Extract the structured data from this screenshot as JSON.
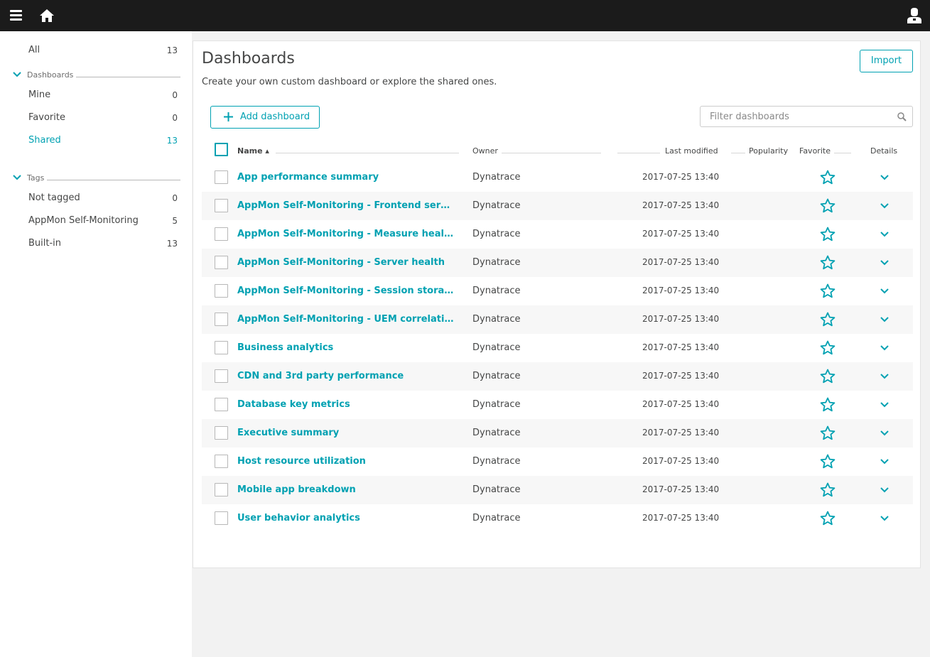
{
  "colors": {
    "accent": "#00a1b2",
    "topbar": "#1b1b1b",
    "text": "#454646",
    "background": "#f2f2f2"
  },
  "topbar": {
    "icons": [
      "menu-icon",
      "home-icon",
      "user-icon"
    ]
  },
  "sidebar": {
    "all": {
      "label": "All",
      "count": "13"
    },
    "groups": [
      {
        "label": "Dashboards",
        "items": [
          {
            "label": "Mine",
            "count": "0"
          },
          {
            "label": "Favorite",
            "count": "0"
          },
          {
            "label": "Shared",
            "count": "13",
            "active": true
          }
        ]
      },
      {
        "label": "Tags",
        "items": [
          {
            "label": "Not tagged",
            "count": "0"
          },
          {
            "label": "AppMon Self-Monitoring",
            "count": "5"
          },
          {
            "label": "Built-in",
            "count": "13"
          }
        ]
      }
    ]
  },
  "main": {
    "title": "Dashboards",
    "subtitle": "Create your own custom dashboard or explore the shared ones.",
    "import_label": "Import",
    "add_label": "Add dashboard",
    "filter_placeholder": "Filter dashboards",
    "columns": {
      "name": "Name ▴",
      "owner": "Owner",
      "last_modified": "Last modified",
      "popularity": "Popularity",
      "favorite": "Favorite",
      "details": "Details"
    },
    "rows": [
      {
        "name": "App performance summary",
        "owner": "Dynatrace",
        "modified": "2017-07-25 13:40"
      },
      {
        "name": "AppMon Self-Monitoring - Frontend server health",
        "owner": "Dynatrace",
        "modified": "2017-07-25 13:40"
      },
      {
        "name": "AppMon Self-Monitoring - Measure health",
        "owner": "Dynatrace",
        "modified": "2017-07-25 13:40"
      },
      {
        "name": "AppMon Self-Monitoring - Server health",
        "owner": "Dynatrace",
        "modified": "2017-07-25 13:40"
      },
      {
        "name": "AppMon Self-Monitoring - Session storage",
        "owner": "Dynatrace",
        "modified": "2017-07-25 13:40"
      },
      {
        "name": "AppMon Self-Monitoring - UEM correlation",
        "owner": "Dynatrace",
        "modified": "2017-07-25 13:40"
      },
      {
        "name": "Business analytics",
        "owner": "Dynatrace",
        "modified": "2017-07-25 13:40"
      },
      {
        "name": "CDN and 3rd party performance",
        "owner": "Dynatrace",
        "modified": "2017-07-25 13:40"
      },
      {
        "name": "Database key metrics",
        "owner": "Dynatrace",
        "modified": "2017-07-25 13:40"
      },
      {
        "name": "Executive summary",
        "owner": "Dynatrace",
        "modified": "2017-07-25 13:40"
      },
      {
        "name": "Host resource utilization",
        "owner": "Dynatrace",
        "modified": "2017-07-25 13:40"
      },
      {
        "name": "Mobile app breakdown",
        "owner": "Dynatrace",
        "modified": "2017-07-25 13:40"
      },
      {
        "name": "User behavior analytics",
        "owner": "Dynatrace",
        "modified": "2017-07-25 13:40"
      }
    ]
  }
}
